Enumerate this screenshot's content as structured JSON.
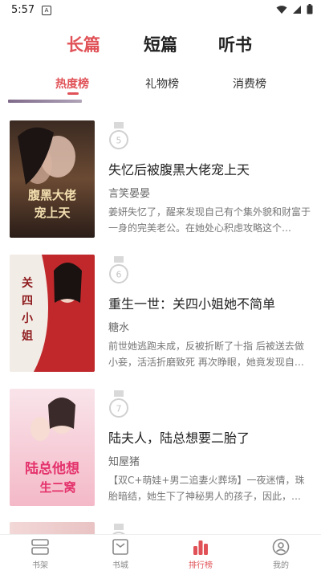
{
  "status_bar": {
    "time": "5:57",
    "notification_icon": "a-icon",
    "icons": [
      "wifi-icon",
      "signal-icon",
      "battery-icon"
    ]
  },
  "top_tabs": [
    {
      "label": "长篇",
      "active": true
    },
    {
      "label": "短篇",
      "active": false
    },
    {
      "label": "听书",
      "active": false
    }
  ],
  "sub_tabs": [
    {
      "label": "热度榜",
      "active": true
    },
    {
      "label": "礼物榜",
      "active": false
    },
    {
      "label": "消费榜",
      "active": false
    }
  ],
  "books": [
    {
      "rank": "5",
      "title": "失忆后被腹黑大佬宠上天",
      "author": "言笑晏晏",
      "desc": "姜妍失忆了，醒来发现自己有个集外貌和财富于一身的完美老公。在她处心积虑攻略这个…",
      "cover_text": "失忆后被腹黑大佬宠上天"
    },
    {
      "rank": "6",
      "title": "重生一世：关四小姐她不简单",
      "author": "糖水",
      "desc": "前世她逃跑未成，反被折断了十指 后被送去做小妾，活活折磨致死 再次睁眼，她竟发现自…",
      "cover_text": "关四小姐她不简单"
    },
    {
      "rank": "7",
      "title": "陆夫人，陆总想要二胎了",
      "author": "知屋猪",
      "desc": "【双C+萌娃+男二追妻火葬场】一夜迷情，珠胎暗结，她生下了神秘男人的孩子，因此，…",
      "cover_text": "陆总他想生二窝"
    }
  ],
  "bottom_nav": [
    {
      "label": "书架",
      "icon": "bookshelf-icon",
      "active": false
    },
    {
      "label": "书城",
      "icon": "store-icon",
      "active": false
    },
    {
      "label": "排行榜",
      "icon": "ranking-icon",
      "active": true
    },
    {
      "label": "我的",
      "icon": "profile-icon",
      "active": false
    }
  ],
  "colors": {
    "accent": "#e05257",
    "text": "#222222",
    "muted": "#777777"
  }
}
